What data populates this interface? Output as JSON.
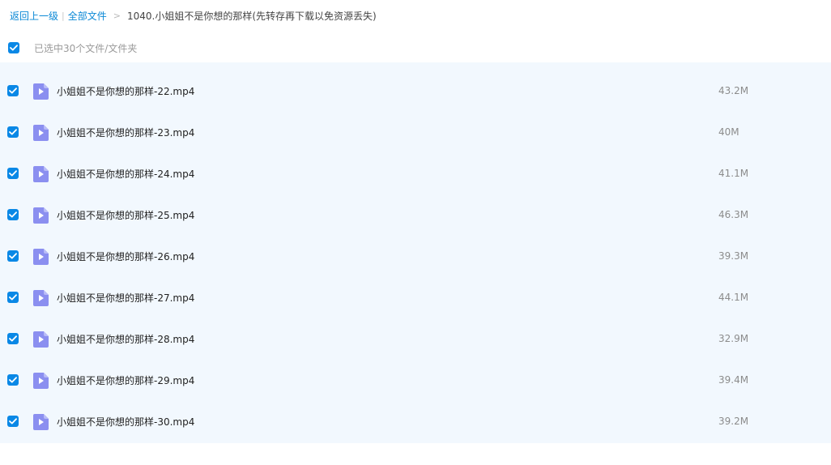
{
  "breadcrumb": {
    "back_label": "返回上一级",
    "all_files_label": "全部文件",
    "current_folder": "1040.小姐姐不是你想的那样(先转存再下载以免资源丢失)"
  },
  "selection": {
    "text": "已选中30个文件/文件夹"
  },
  "colors": {
    "accent": "#0a88e6",
    "link": "#0a88d6",
    "row_background": "#f2f8fe",
    "video_icon": "#8b8ff0"
  },
  "files": [
    {
      "name": "小姐姐不是你想的那样-22.mp4",
      "size": "43.2M",
      "icon": "video-file-icon",
      "checked": true
    },
    {
      "name": "小姐姐不是你想的那样-23.mp4",
      "size": "40M",
      "icon": "video-file-icon",
      "checked": true
    },
    {
      "name": "小姐姐不是你想的那样-24.mp4",
      "size": "41.1M",
      "icon": "video-file-icon",
      "checked": true
    },
    {
      "name": "小姐姐不是你想的那样-25.mp4",
      "size": "46.3M",
      "icon": "video-file-icon",
      "checked": true
    },
    {
      "name": "小姐姐不是你想的那样-26.mp4",
      "size": "39.3M",
      "icon": "video-file-icon",
      "checked": true
    },
    {
      "name": "小姐姐不是你想的那样-27.mp4",
      "size": "44.1M",
      "icon": "video-file-icon",
      "checked": true
    },
    {
      "name": "小姐姐不是你想的那样-28.mp4",
      "size": "32.9M",
      "icon": "video-file-icon",
      "checked": true
    },
    {
      "name": "小姐姐不是你想的那样-29.mp4",
      "size": "39.4M",
      "icon": "video-file-icon",
      "checked": true
    },
    {
      "name": "小姐姐不是你想的那样-30.mp4",
      "size": "39.2M",
      "icon": "video-file-icon",
      "checked": true
    }
  ]
}
